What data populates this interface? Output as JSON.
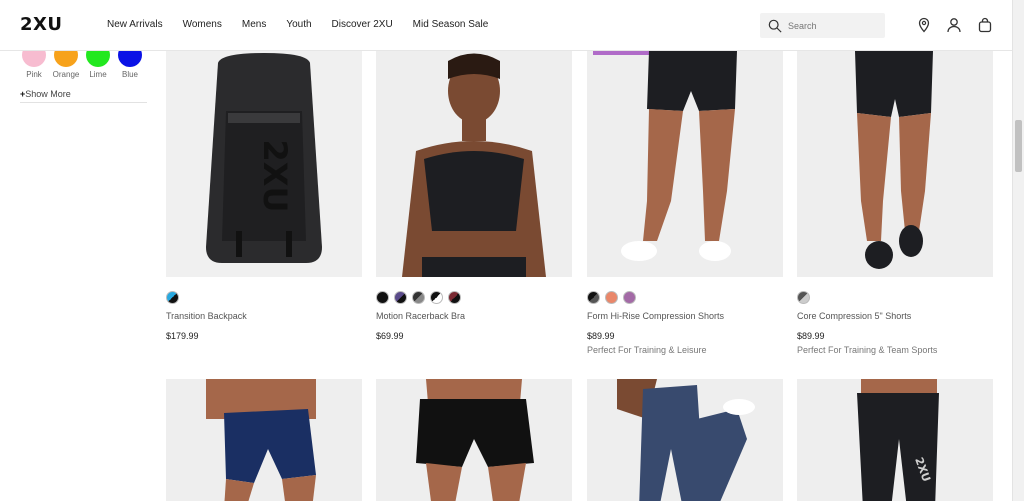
{
  "header": {
    "logo": "2XU",
    "nav": [
      "New Arrivals",
      "Womens",
      "Mens",
      "Youth",
      "Discover 2XU",
      "Mid Season Sale"
    ],
    "search_placeholder": "Search"
  },
  "sidebar": {
    "colors": [
      {
        "label": "Pink",
        "color": "#f7bcd0"
      },
      {
        "label": "Orange",
        "color": "#f7a21b"
      },
      {
        "label": "Lime",
        "color": "#22e81f"
      },
      {
        "label": "Blue",
        "color": "#0a12e6"
      }
    ],
    "show_more": "Show More"
  },
  "products": [
    {
      "name": "Transition Backpack",
      "price": "$179.99",
      "tag": "",
      "swatches": [
        "#29a9e0"
      ]
    },
    {
      "name": "Motion Racerback Bra",
      "price": "$69.99",
      "tag": "",
      "swatches": [
        "#111111",
        "#5a4b8a",
        "#333333",
        "#111111",
        "#7a2a33"
      ]
    },
    {
      "name": "Form Hi-Rise Compression Shorts",
      "price": "$89.99",
      "tag": "Perfect For Training & Leisure",
      "swatches": [
        "#111111",
        "#e9876a",
        "#a36aa6"
      ]
    },
    {
      "name": "Core Compression 5\" Shorts",
      "price": "$89.99",
      "tag": "Perfect For Training & Team Sports",
      "swatches": [
        "#777777"
      ]
    }
  ]
}
